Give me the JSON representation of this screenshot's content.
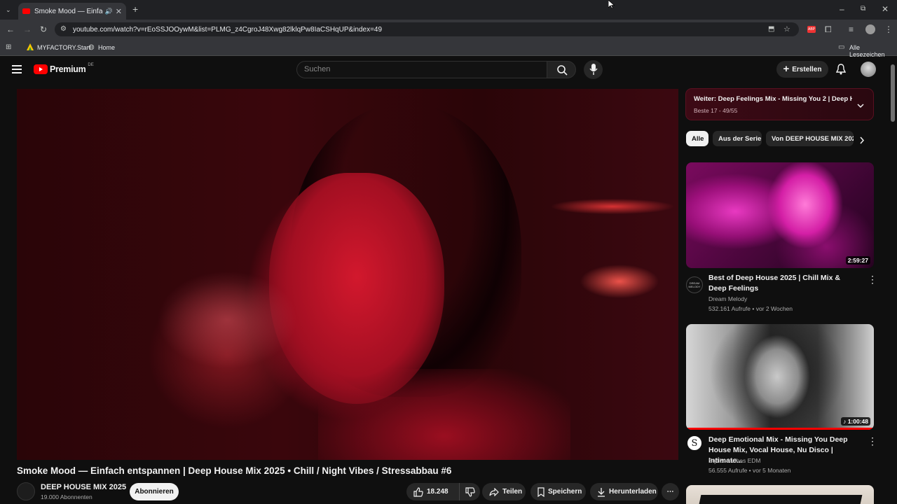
{
  "browser": {
    "tab_title": "Smoke Mood — Einfach en",
    "url": "youtube.com/watch?v=rEoSSJOOywM&list=PLMG_z4CgroJ48Xwg82lklqPw8IaCSHqUP&index=49",
    "bookmarks": [
      "MYFACTORY.Start",
      "Home"
    ],
    "all_bookmarks": "Alle Lesezeichen"
  },
  "header": {
    "logo_text": "Premium",
    "logo_badge": "DE",
    "search_placeholder": "Suchen",
    "create_label": "Erstellen"
  },
  "video": {
    "title": "Smoke Mood — Einfach entspannen | Deep House Mix 2025 • Chill / Night Vibes / Stressabbau #6",
    "channel": "DEEP HOUSE MIX 2025",
    "subscribers": "19.000 Abonnenten",
    "subscribe_label": "Abonnieren",
    "likes": "18.248",
    "share_label": "Teilen",
    "save_label": "Speichern",
    "download_label": "Herunterladen"
  },
  "playlist": {
    "title": "Weiter: Deep Feelings Mix - Missing You 2 | Deep H...",
    "subtitle": "Beste 17 - 49/55"
  },
  "chips": [
    "Alle",
    "Aus der Serie",
    "Von DEEP HOUSE MIX 2025"
  ],
  "recommendations": [
    {
      "title": "Best of Deep House 2025 | Chill Mix & Deep Feelings",
      "channel": "Dream Melody",
      "meta": "532.161 Aufrufe • vor 2 Wochen",
      "duration": "2:59:27",
      "avatar_text": "DREAM MELODY"
    },
    {
      "title": "Deep Emotional Mix - Missing You Deep House Mix, Vocal House, Nu Disco | Intimate...",
      "channel": "Stylized Vibes EDM",
      "meta": "56.555 Aufrufe • vor 5 Monaten",
      "duration": "1:00:48",
      "avatar_text": "S"
    }
  ],
  "colors": {
    "accent_red": "#ff0000",
    "background": "#0f0f0f"
  }
}
